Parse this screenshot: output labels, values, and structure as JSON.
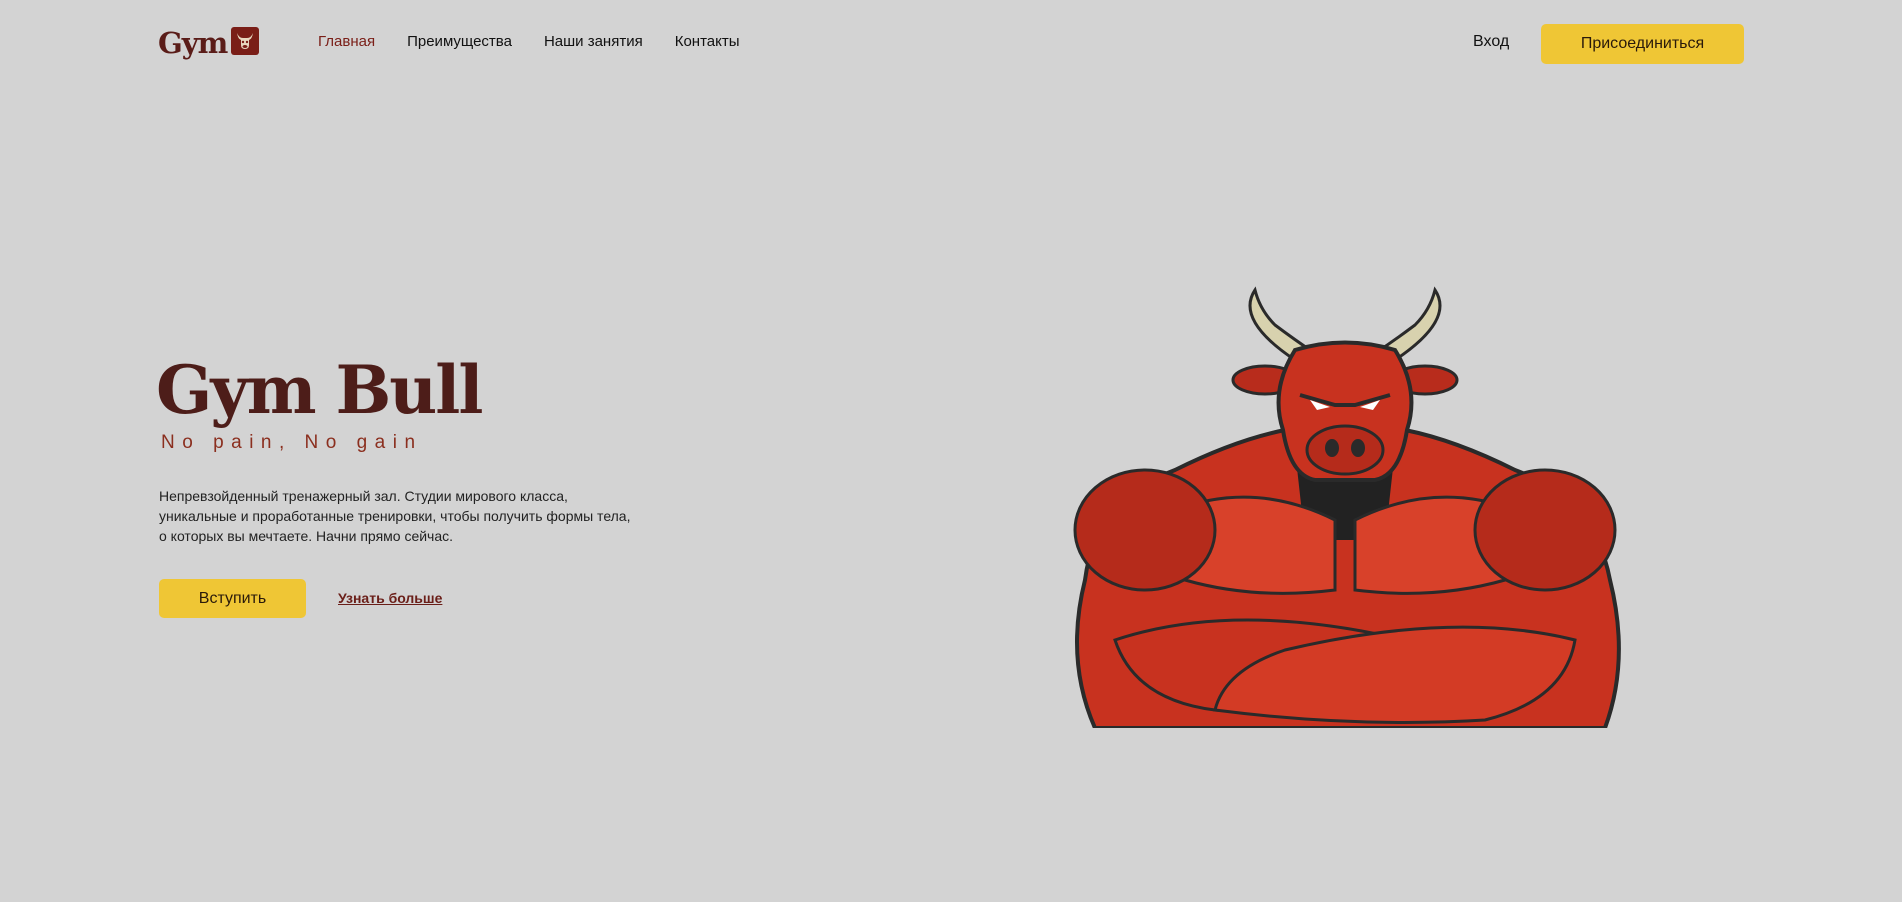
{
  "header": {
    "logo_text": "Gym",
    "logo_icon": "bull-head-icon",
    "nav": [
      {
        "label": "Главная",
        "active": true
      },
      {
        "label": "Преимущества",
        "active": false
      },
      {
        "label": "Наши занятия",
        "active": false
      },
      {
        "label": "Контакты",
        "active": false
      }
    ],
    "login_label": "Вход",
    "join_label": "Присоединиться"
  },
  "hero": {
    "title": "Gym Bull",
    "slogan": "No pain, No gain",
    "description": "Непревзойденный тренажерный зал. Студии мирового класса, уникальные и проработанные тренировки, чтобы получить формы тела, о которых вы мечтаете. Начни прямо сейчас.",
    "cta_label": "Вступить",
    "learn_more_label": "Узнать больше",
    "image": "muscular-bull-illustration"
  },
  "colors": {
    "background": "#d3d3d3",
    "accent_yellow": "#efc635",
    "brand_dark_red": "#4d1d19",
    "bull_red": "#c8321f"
  }
}
